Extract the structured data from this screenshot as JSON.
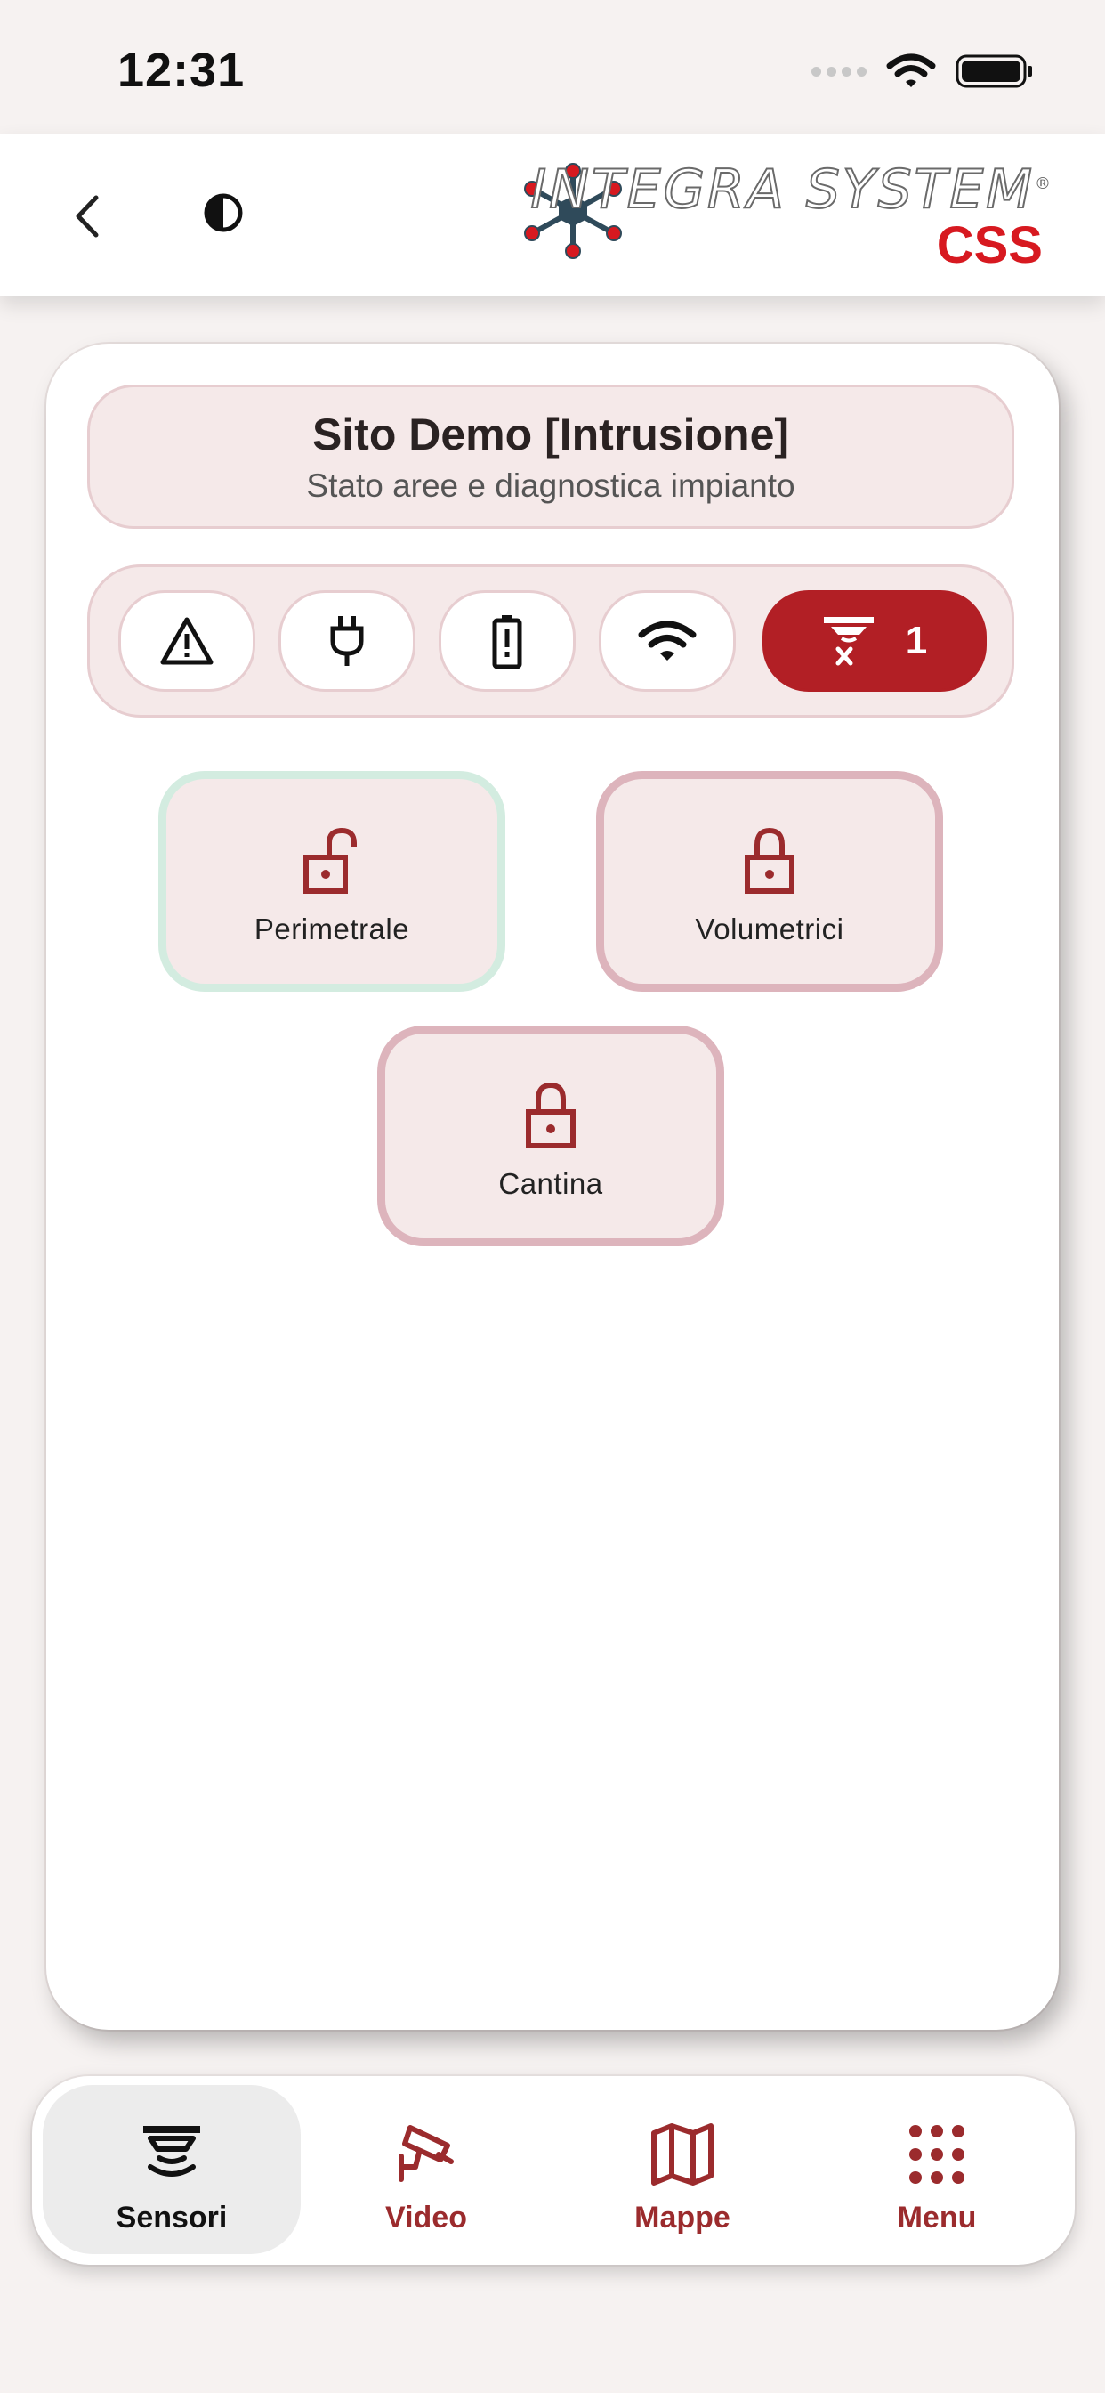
{
  "status_bar": {
    "time": "12:31"
  },
  "header": {
    "logo_title": "INTEGRA SYSTEM",
    "logo_trademark": "®",
    "logo_subtitle": "CSS"
  },
  "site": {
    "title": "Sito Demo [Intrusione]",
    "subtitle": "Stato aree e diagnostica impianto"
  },
  "diagnostics": [
    {
      "icon": "warning-icon"
    },
    {
      "icon": "power-plug-icon"
    },
    {
      "icon": "battery-icon"
    },
    {
      "icon": "wifi-icon"
    },
    {
      "icon": "sensor-fault-icon",
      "count": "1",
      "color": "#b21f25"
    }
  ],
  "areas": [
    {
      "label": "Perimetrale",
      "state": "unlocked",
      "icon": "unlocked-padlock-icon",
      "border_color": "#d3ece0"
    },
    {
      "label": "Volumetrici",
      "state": "locked",
      "icon": "padlock-icon",
      "border_color": "#ddb4bc"
    },
    {
      "label": "Cantina",
      "state": "locked",
      "icon": "padlock-icon",
      "border_color": "#ddb4bc"
    }
  ],
  "nav": [
    {
      "label": "Sensori",
      "icon": "sensor-icon",
      "active": true
    },
    {
      "label": "Video",
      "icon": "camera-icon",
      "active": false
    },
    {
      "label": "Mappe",
      "icon": "map-icon",
      "active": false
    },
    {
      "label": "Menu",
      "icon": "grid-icon",
      "active": false
    }
  ],
  "colors": {
    "accent": "#9b2b2d",
    "alert": "#b21f25",
    "panel_bg": "#f5e9e9",
    "panel_border": "#e7cdd0"
  }
}
